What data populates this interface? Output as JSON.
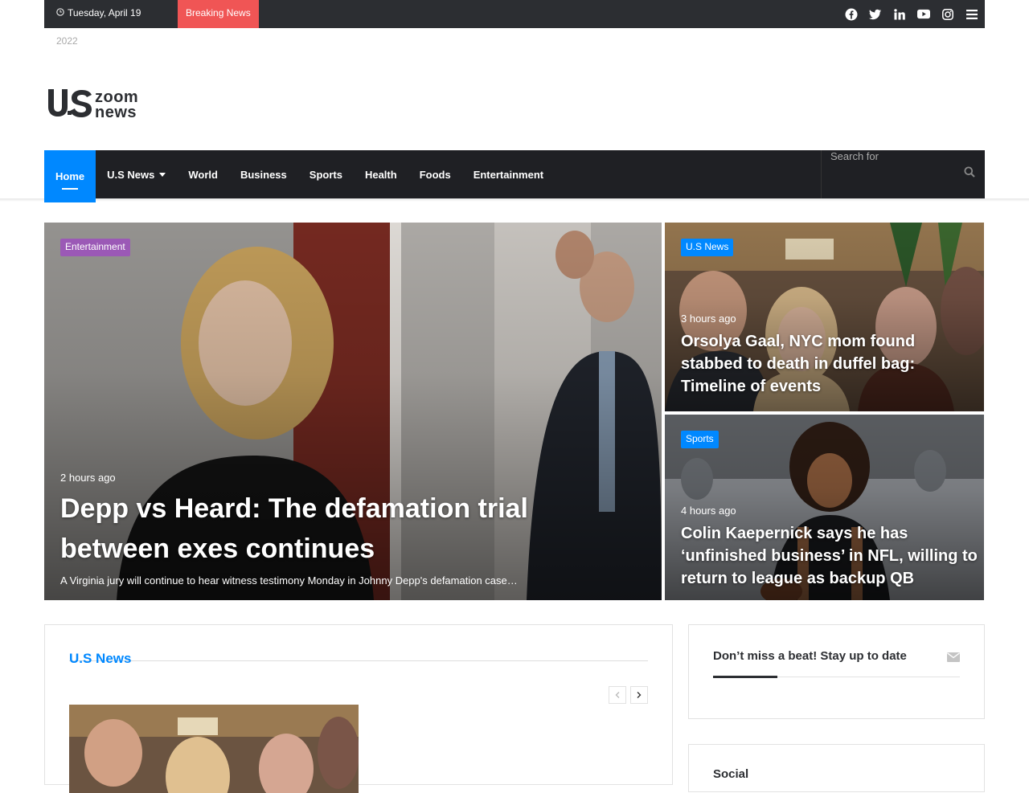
{
  "topbar": {
    "date": "Tuesday, April 19",
    "year": "2022",
    "breaking_label": "Breaking News",
    "social": [
      "facebook-icon",
      "twitter-icon",
      "linkedin-icon",
      "youtube-icon",
      "instagram-icon",
      "menu-icon"
    ]
  },
  "logo": {
    "alt": "US Zoom News",
    "line1": "zoom",
    "line2": "news"
  },
  "nav": {
    "items": [
      {
        "label": "Home",
        "active": true
      },
      {
        "label": "U.S News",
        "dropdown": true
      },
      {
        "label": "World"
      },
      {
        "label": "Business"
      },
      {
        "label": "Sports"
      },
      {
        "label": "Health"
      },
      {
        "label": "Foods"
      },
      {
        "label": "Entertainment"
      }
    ],
    "search_placeholder": "Search for"
  },
  "hero": {
    "main": {
      "category": "Entertainment",
      "time": "2 hours ago",
      "title": "Depp vs Heard: The defamation trial between exes continues",
      "excerpt": "A Virginia jury will continue to hear witness testimony Monday in Johnny Depp's defamation case…"
    },
    "side1": {
      "category": "U.S News",
      "time": "3 hours ago",
      "title": "Orsolya Gaal, NYC mom found stabbed to death in duffel bag: Timeline of events"
    },
    "side2": {
      "category": "Sports",
      "time": "4 hours ago",
      "title": "Colin Kaepernick says he has ‘unfinished business’ in NFL, willing to return to league as backup QB"
    }
  },
  "section": {
    "title": "U.S News"
  },
  "widgets": {
    "newsletter_title": "Don’t miss a beat! Stay up to date",
    "social_title": "Social"
  },
  "colors": {
    "accent": "#0088ff",
    "dark": "#1f2024",
    "breaking": "#f05555",
    "entertainment": "#9b59b6"
  }
}
